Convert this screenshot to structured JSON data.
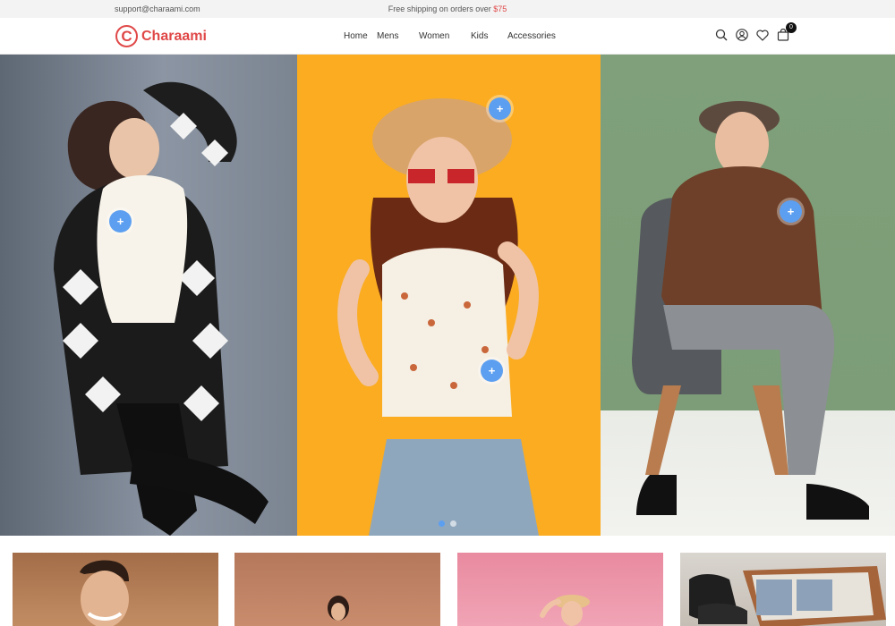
{
  "topbar": {
    "email": "support@charaami.com",
    "shipping_text": "Free shipping on orders over ",
    "shipping_amount": "$75"
  },
  "brand": {
    "logo_letter": "C",
    "name": "Charaami",
    "color": "#e04848"
  },
  "nav": {
    "items": [
      {
        "label": "Home"
      },
      {
        "label": "Mens"
      },
      {
        "label": "Women"
      },
      {
        "label": "Kids"
      },
      {
        "label": "Accessories"
      }
    ]
  },
  "header_icons": {
    "search": "search-icon",
    "account": "user-icon",
    "wishlist": "heart-icon",
    "cart": "cart-icon",
    "cart_count": "0"
  },
  "hero": {
    "hotspot_label": "+",
    "hotspot_color": "#5c9ff0",
    "slide_count": 2,
    "active_slide": 1
  }
}
